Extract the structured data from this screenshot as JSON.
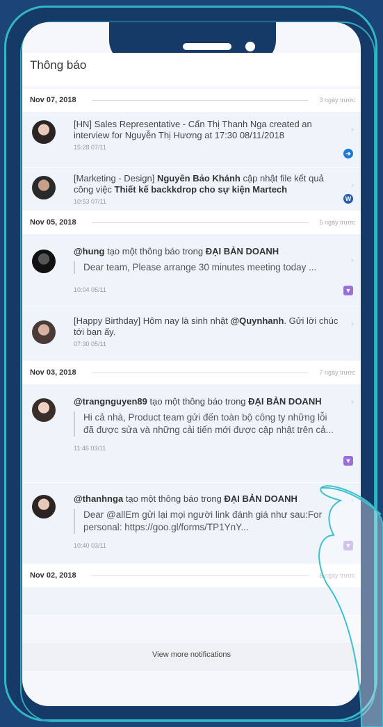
{
  "page": {
    "title": "Thông báo"
  },
  "groups": [
    {
      "date": "Nov 07, 2018",
      "ago": "3 ngày trước",
      "items": [
        {
          "text_plain": "[HN] Sales Representative - Cấn Thị Thanh Nga created an interview for Nguyễn Thị Hương at 17:30 08/11/2018",
          "time": "15:28 07/11",
          "badge": "➔",
          "badge_color": "#1e7ad0"
        },
        {
          "text_pre": "[Marketing - Design] ",
          "text_bold": "Nguyên Bảo Khánh",
          "text_post": " cập nhật file kết quả công việc ",
          "text_bold2": "Thiết kế backkdrop cho sự kiện Martech",
          "time": "10:53 07/11",
          "badge": "W",
          "badge_color": "#2a5bb0"
        }
      ]
    },
    {
      "date": "Nov 05, 2018",
      "ago": "5 ngày trước",
      "items": [
        {
          "text_user": "@hung",
          "text_mid": " tạo một thông báo trong ",
          "text_group": "ĐẠI BẢN DOANH",
          "quote": "Dear team, Please arrange 30 minutes meeting today ...",
          "time": "10:04 05/11",
          "badge": "▼",
          "badge_color": "#9a6fd6"
        },
        {
          "text_pre": "[Happy Birthday] Hôm nay là sinh nhật ",
          "text_bold": "@Quynhanh",
          "text_post": ". Gửi lời chúc tới bạn ấy.",
          "time": "07:30 05/11"
        }
      ]
    },
    {
      "date": "Nov 03, 2018",
      "ago": "7 ngày trước",
      "items": [
        {
          "text_user": "@trangnguyen89",
          "text_mid": " tạo một thông báo trong ",
          "text_group": "ĐẠI BẢN DOANH",
          "quote": "Hi cả nhà,  Product team gửi đến toàn bộ công ty những lỗi đã được sửa và những cải tiến mới được cập nhật trên cả...",
          "time": "11:46 03/11",
          "badge": "▼",
          "badge_color": "#9a6fd6"
        },
        {
          "text_user": "@thanhnga",
          "text_mid": " tạo một thông báo trong ",
          "text_group": "ĐẠI BẢN DOANH",
          "quote": "Dear @allEm gửi lại mọi người link đánh giá như sau:For personal: https://goo.gl/forms/TP1YnY...",
          "time": "10:40 03/11",
          "badge": "▼",
          "badge_color": "#9a6fd6"
        }
      ]
    },
    {
      "date": "Nov 02, 2018",
      "ago": "8 ngày trước",
      "items": []
    }
  ],
  "footer": {
    "view_more": "View more notifications"
  }
}
